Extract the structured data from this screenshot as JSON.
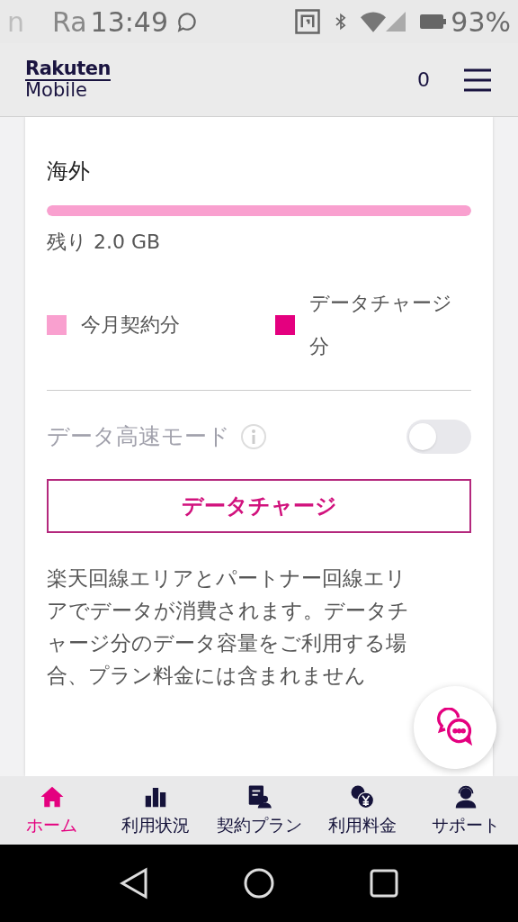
{
  "status_bar": {
    "left_cut": "n",
    "carrier": "Ra",
    "time": "13:49",
    "battery": "93%"
  },
  "header": {
    "logo_top": "Rakuten",
    "logo_bottom": "Mobile",
    "count": "0"
  },
  "data_card": {
    "title": "海外",
    "level": 1.0,
    "remaining": "残り 2.0 GB",
    "legend": [
      {
        "label": "今月契約分",
        "color": "#f9a0cf"
      },
      {
        "label": "データチャージ分",
        "color": "#e4007f"
      }
    ],
    "high_speed_mode": {
      "label": "データ高速モード",
      "on": false
    },
    "charge_button": "データチャージ",
    "note": "楽天回線エリアとパートナー回線エリアでデータが消費されます。データチャージ分のデータ容量をご利用する場合、プラン料金には含まれません"
  },
  "bottom_nav": [
    {
      "label": "ホーム",
      "selected": true
    },
    {
      "label": "利用状況",
      "selected": false
    },
    {
      "label": "契約プラン",
      "selected": false
    },
    {
      "label": "利用料金",
      "selected": false
    },
    {
      "label": "サポート",
      "selected": false
    }
  ]
}
